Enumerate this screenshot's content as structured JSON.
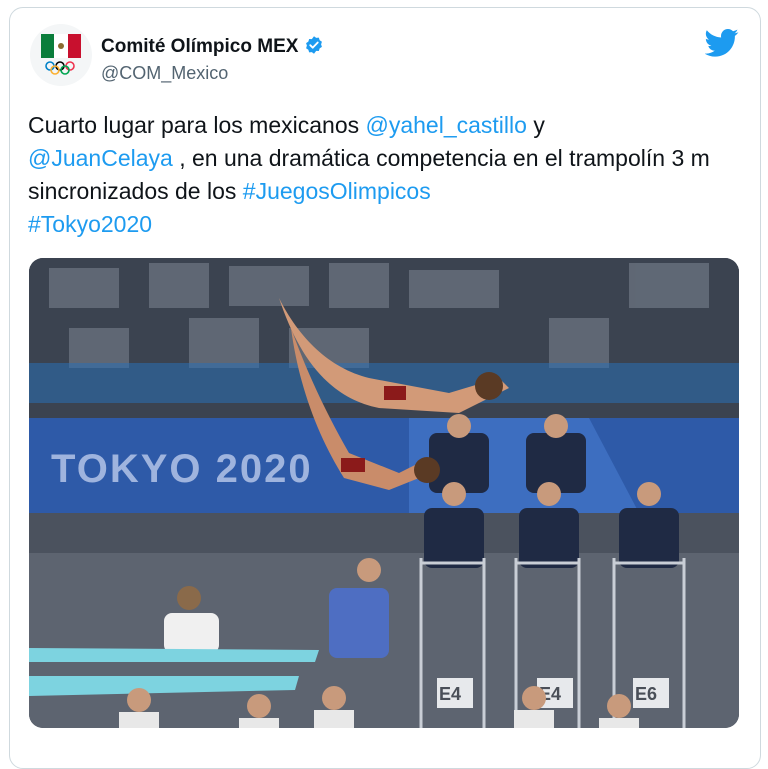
{
  "tweet": {
    "author_name": "Comité Olímpico MEX",
    "handle": "@COM_Mexico",
    "text_1": "Cuarto lugar para los mexicanos ",
    "mention_1": "@yahel_castillo",
    "text_2": " y ",
    "mention_2": "@JuanCelaya",
    "text_3": " , en una dramática competencia en el trampolín 3 m sincronizados de los ",
    "hashtag_1": "#JuegosOlimpicos",
    "text_4": " ",
    "hashtag_2": "#Tokyo2020"
  },
  "photo": {
    "banner_text": "TOKYO 2020",
    "sign_1": "E4",
    "sign_2": "E4",
    "sign_3": "E6"
  },
  "colors": {
    "link": "#1d9bf0",
    "verified": "#1d9bf0",
    "twitter_brand": "#1d9bf0",
    "banner": "#2e5aa8"
  },
  "icons": {
    "verified": "verified-badge-icon",
    "brand": "twitter-bird-icon"
  }
}
